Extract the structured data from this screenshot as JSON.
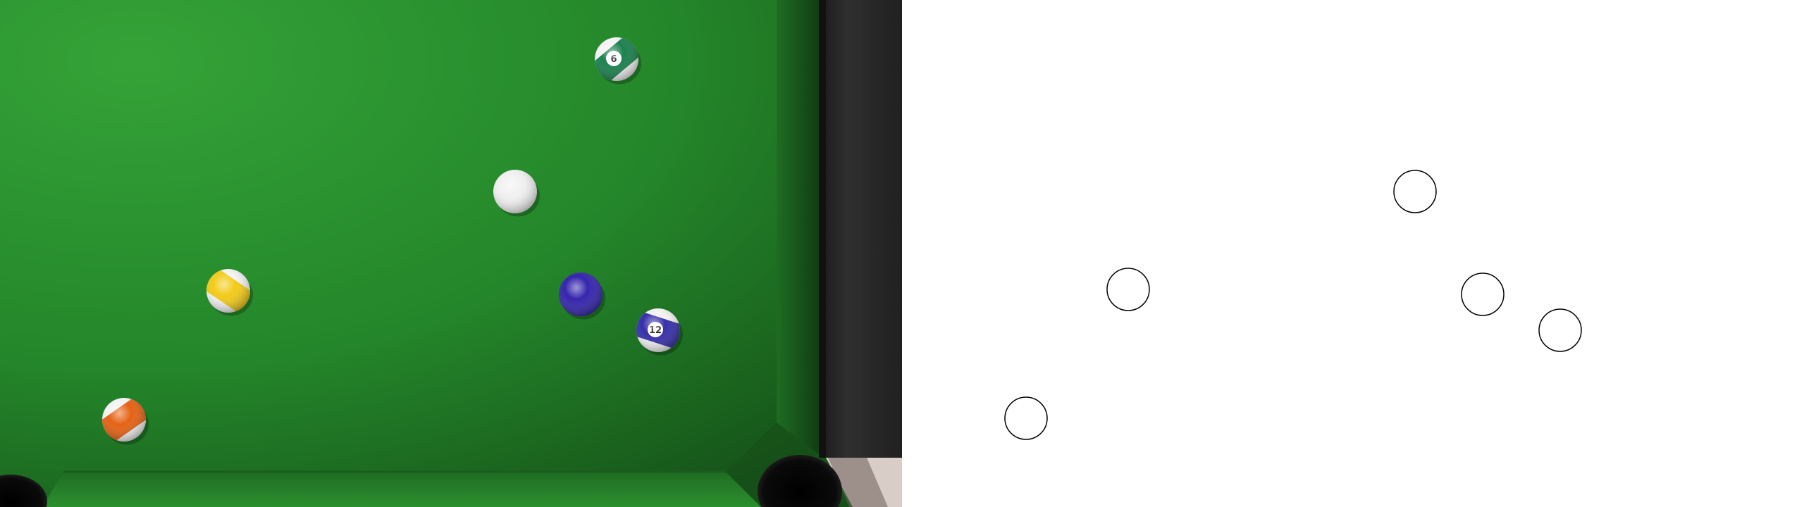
{
  "scene": {
    "table": {
      "felt_color": "#2e9a31",
      "felt_shadow_color": "#1c5a1e",
      "rail_color": "#2a2a2a",
      "pocket_color": "#050505"
    },
    "balls": [
      {
        "name": "ball-6",
        "label": "6",
        "kind": "stripe",
        "color": "#0f7a45",
        "interactable": true
      },
      {
        "name": "cue-ball",
        "label": "",
        "kind": "cue",
        "color": "#f0f0f0",
        "interactable": true
      },
      {
        "name": "ball-yellow",
        "label": "",
        "kind": "stripe",
        "color": "#f2c80d",
        "interactable": true
      },
      {
        "name": "ball-blue",
        "label": "",
        "kind": "solid",
        "color": "#2a1aa8",
        "interactable": true
      },
      {
        "name": "ball-12",
        "label": "12",
        "kind": "stripe",
        "color": "#2c25a6",
        "interactable": true
      },
      {
        "name": "ball-orange",
        "label": "",
        "kind": "stripe",
        "color": "#e45a08",
        "interactable": true
      }
    ],
    "overlay": {
      "circle_stroke": "#000000",
      "circle_fill": "#ffffff",
      "circles": [
        {
          "name": "overlay-circle-1"
        },
        {
          "name": "overlay-circle-2"
        },
        {
          "name": "overlay-circle-3"
        },
        {
          "name": "overlay-circle-4"
        },
        {
          "name": "overlay-circle-5"
        }
      ]
    }
  }
}
